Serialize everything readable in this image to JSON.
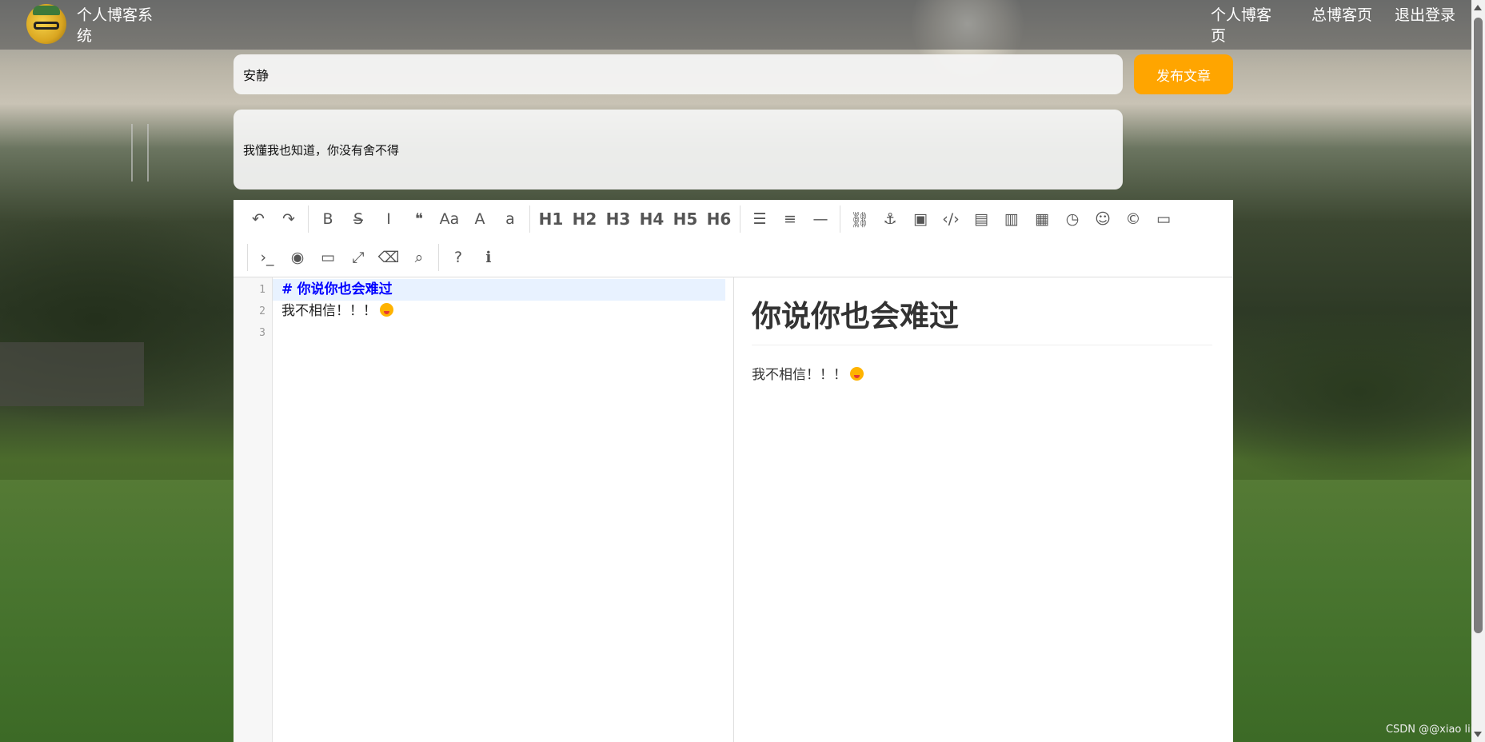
{
  "nav": {
    "brand": "个人博客系统",
    "links": [
      "个人博客页",
      "总博客页",
      "退出登录"
    ]
  },
  "article": {
    "title_value": "安静",
    "publish_label": "发布文章",
    "summary": "我懂我也知道，你没有舍不得"
  },
  "toolbar": {
    "row1": [
      {
        "icon": "undo-icon",
        "glyph": "↶"
      },
      {
        "icon": "redo-icon",
        "glyph": "↷"
      },
      {
        "sep": true
      },
      {
        "icon": "bold-icon",
        "glyph": "B"
      },
      {
        "icon": "strikethrough-icon",
        "glyph": "S̶"
      },
      {
        "icon": "italic-icon",
        "glyph": "I"
      },
      {
        "icon": "quote-icon",
        "glyph": "❝"
      },
      {
        "icon": "uppercase-icon",
        "glyph": "Aa"
      },
      {
        "icon": "font-a-icon",
        "glyph": "A"
      },
      {
        "icon": "lowercase-icon",
        "glyph": "a"
      },
      {
        "sep": true
      },
      {
        "icon": "h1-icon",
        "glyph": "H1",
        "h": true
      },
      {
        "icon": "h2-icon",
        "glyph": "H2",
        "h": true
      },
      {
        "icon": "h3-icon",
        "glyph": "H3",
        "h": true
      },
      {
        "icon": "h4-icon",
        "glyph": "H4",
        "h": true
      },
      {
        "icon": "h5-icon",
        "glyph": "H5",
        "h": true
      },
      {
        "icon": "h6-icon",
        "glyph": "H6",
        "h": true
      },
      {
        "sep": true
      },
      {
        "icon": "unordered-list-icon",
        "glyph": "☰"
      },
      {
        "icon": "ordered-list-icon",
        "glyph": "≡"
      },
      {
        "icon": "horizontal-rule-icon",
        "glyph": "—"
      },
      {
        "sep": true
      },
      {
        "icon": "link-icon",
        "glyph": "⛓"
      },
      {
        "icon": "anchor-icon",
        "glyph": "⚓"
      },
      {
        "icon": "image-icon",
        "glyph": "▣"
      },
      {
        "icon": "code-icon",
        "glyph": "‹/›"
      },
      {
        "icon": "code-block-icon",
        "glyph": "▤"
      },
      {
        "icon": "preformatted-icon",
        "glyph": "▥"
      },
      {
        "icon": "table-icon",
        "glyph": "▦"
      },
      {
        "icon": "datetime-icon",
        "glyph": "◷"
      },
      {
        "icon": "emoji-icon",
        "glyph": "☺"
      },
      {
        "icon": "html-entities-icon",
        "glyph": "©"
      },
      {
        "icon": "pagebreak-icon",
        "glyph": "▭"
      }
    ],
    "row2": [
      {
        "sep": true
      },
      {
        "icon": "terminal-icon",
        "glyph": "›_"
      },
      {
        "icon": "watch-toggle-icon",
        "glyph": "◉"
      },
      {
        "icon": "preview-icon",
        "glyph": "▭"
      },
      {
        "icon": "fullscreen-icon",
        "glyph": "⤢"
      },
      {
        "icon": "eraser-icon",
        "glyph": "⌫"
      },
      {
        "icon": "search-icon",
        "glyph": "⌕"
      },
      {
        "sep": true
      },
      {
        "icon": "help-icon",
        "glyph": "?"
      },
      {
        "icon": "info-icon",
        "glyph": "ℹ"
      }
    ]
  },
  "editor": {
    "line_numbers": [
      "1",
      "2",
      "3"
    ],
    "line1_hash": "#",
    "line1_text": "你说你也会难过",
    "line2_text": "我不相信！！！",
    "preview_heading": "你说你也会难过",
    "preview_paragraph": "我不相信！！！"
  },
  "watermark": "CSDN @@xiao lin"
}
